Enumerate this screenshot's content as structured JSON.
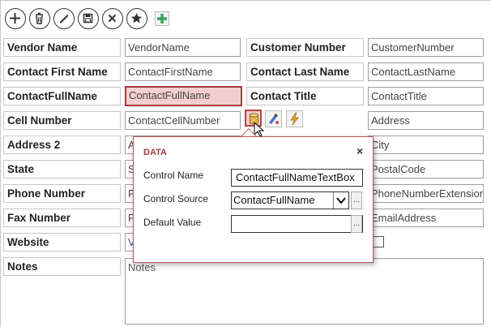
{
  "toolbar": {
    "icons": [
      "add-icon",
      "delete-icon",
      "edit-icon",
      "save-icon",
      "cancel-icon",
      "star-icon",
      "add-field-icon"
    ]
  },
  "form": {
    "vendor_name": {
      "label": "Vendor Name",
      "value": "VendorName"
    },
    "customer_number": {
      "label": "Customer Number",
      "value": "CustomerNumber"
    },
    "contact_first_name": {
      "label": "Contact First Name",
      "value": "ContactFirstName"
    },
    "contact_last_name": {
      "label": "Contact Last Name",
      "value": "ContactLastName"
    },
    "contact_full_name": {
      "label": "ContactFullName",
      "value": "ContactFullName"
    },
    "contact_title": {
      "label": "Contact Title",
      "value": "ContactTitle"
    },
    "cell_number": {
      "label": "Cell Number",
      "value": "ContactCellNumber"
    },
    "address": {
      "value": "Address"
    },
    "address2": {
      "label": "Address 2",
      "value_fragment": "A"
    },
    "city": {
      "value": "City"
    },
    "state": {
      "label": "State",
      "value_fragment": "S"
    },
    "postal_code": {
      "value": "PostalCode"
    },
    "phone_number": {
      "label": "Phone Number",
      "value_fragment": "P"
    },
    "phone_ext": {
      "value": "PhoneNumberExtension"
    },
    "fax_number": {
      "label": "Fax Number",
      "value_fragment": "F"
    },
    "email": {
      "value": "EmailAddress"
    },
    "website": {
      "label": "Website",
      "value_fragment": "V"
    },
    "notes": {
      "label": "Notes",
      "value": "Notes"
    }
  },
  "field_tools": {
    "icons": [
      "database-icon",
      "format-icon",
      "event-icon"
    ]
  },
  "popup": {
    "title": "DATA",
    "close": "×",
    "control_name_label": "Control Name",
    "control_name_value": "ContactFullNameTextBox",
    "control_source_label": "Control Source",
    "control_source_value": "ContactFullName",
    "default_value_label": "Default Value",
    "default_value_value": "",
    "ellipsis": "..."
  },
  "colors": {
    "accent": "#a93a3a",
    "selected_bg": "#f3cfcf",
    "add_green": "#3ca35a"
  }
}
